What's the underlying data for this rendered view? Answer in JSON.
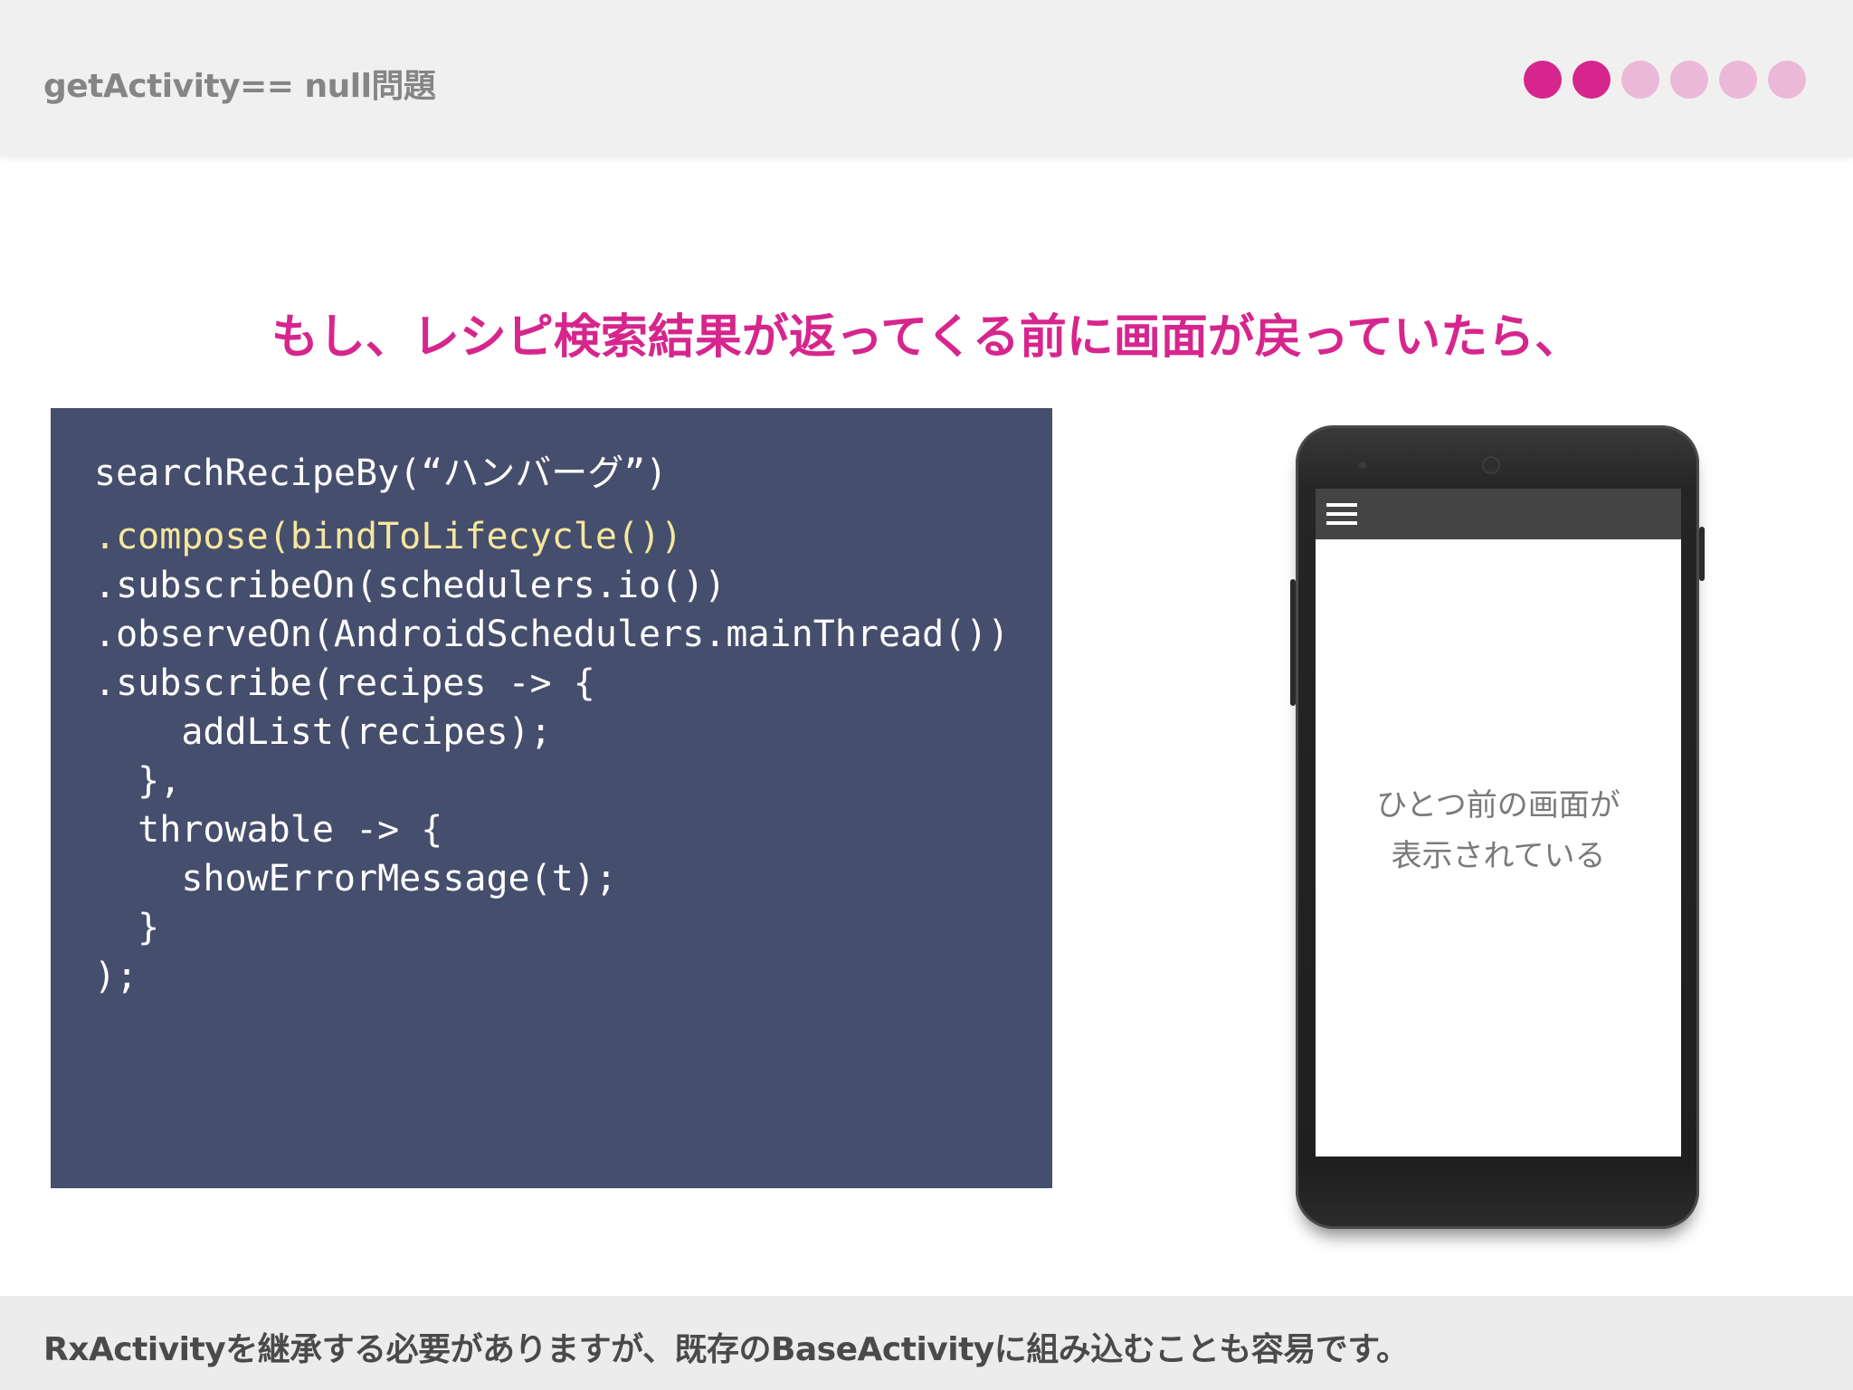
{
  "header": {
    "title": "getActivity== null問題",
    "progress_dots": {
      "total": 6,
      "active": 2,
      "active_color": "#d6268d",
      "inactive_color": "#ecb8d8"
    }
  },
  "headline": "もし、レシピ検索結果が返ってくる前に画面が戻っていたら、",
  "code": {
    "lines": [
      "searchRecipeBy(“ハンバーグ”)",
      ".compose(bindToLifecycle())",
      ".subscribeOn(schedulers.io())",
      ".observeOn(AndroidSchedulers.mainThread())",
      ".subscribe(recipes -> {",
      "    addList(recipes);",
      "  },",
      "  throwable -> {",
      "    showErrorMessage(t);",
      "  }",
      ");"
    ],
    "highlighted_line": 1,
    "background": "#464e6d",
    "highlight_color": "#f5e79e"
  },
  "phone": {
    "menu_icon": "hamburger-menu-icon",
    "screen_text_line1": "ひとつ前の画面が",
    "screen_text_line2": "表示されている"
  },
  "footer": {
    "text": "RxActivityを継承する必要がありますが、既存のBaseActivityに組み込むことも容易です。"
  }
}
